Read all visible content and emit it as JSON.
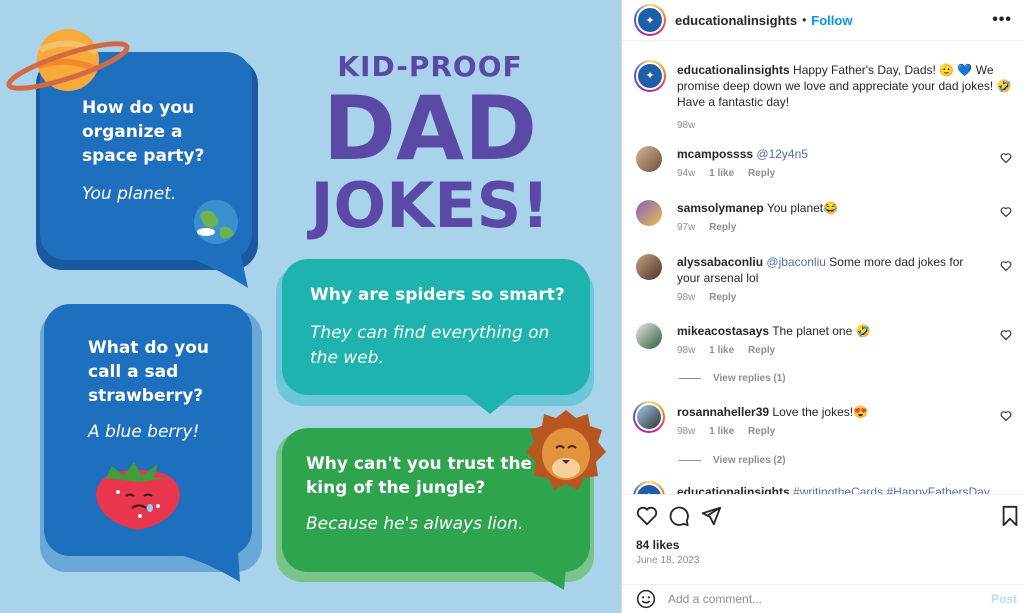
{
  "image": {
    "headline_top": "KID-PROOF",
    "headline_big": "DAD",
    "headline_bottom": "JOKES!",
    "jokes": [
      {
        "q": "How do you organize a space party?",
        "a": "You planet."
      },
      {
        "q": "What do you call a sad strawberry?",
        "a": "A blue berry!"
      },
      {
        "q": "Why are spiders so smart?",
        "a": "They can find everything on the web."
      },
      {
        "q": "Why can't you trust the king of the jungle?",
        "a": "Because he's always lion."
      }
    ],
    "colors": {
      "background": "#a9d3ea",
      "bubble_blue": "#1f6fbf",
      "bubble_teal": "#1fb3b0",
      "bubble_green": "#2fa44f",
      "headline": "#5a4aa6"
    }
  },
  "header": {
    "username": "educationalinsights",
    "separator": "•",
    "follow_label": "Follow",
    "more_icon": "more-horizontal-icon"
  },
  "caption": {
    "username": "educationalinsights",
    "text": "Happy Father's Day, Dads! 🫡 💙 We promise deep down we love and appreciate your dad jokes! 🤣 Have a fantastic day!",
    "time": "98w"
  },
  "comments": [
    {
      "user": "mcampossss",
      "mention": "@12y4n5",
      "text": "",
      "time": "94w",
      "likes": "1 like",
      "reply": "Reply"
    },
    {
      "user": "samsolymanep",
      "mention": "",
      "text": "You planet😂",
      "time": "97w",
      "likes": "",
      "reply": "Reply"
    },
    {
      "user": "alyssabaconliu",
      "mention": "@jbaconliu",
      "text": "Some more dad jokes for your arsenal lol",
      "time": "98w",
      "likes": "",
      "reply": "Reply"
    },
    {
      "user": "mikeacostasays",
      "mention": "",
      "text": "The planet one 🤣",
      "time": "98w",
      "likes": "1 like",
      "reply": "Reply",
      "view_replies": "View replies (1)"
    },
    {
      "user": "rosannaheller39",
      "mention": "",
      "text": "Love the jokes!😍",
      "time": "98w",
      "likes": "1 like",
      "reply": "Reply",
      "view_replies": "View replies (2)"
    }
  ],
  "partial_comment": {
    "user": "educationalinsights",
    "text": "#writingtheCards #HappyFathersDay"
  },
  "footer": {
    "likes": "84 likes",
    "date": "June 18, 2023",
    "comment_placeholder": "Add a comment...",
    "post_label": "Post"
  }
}
